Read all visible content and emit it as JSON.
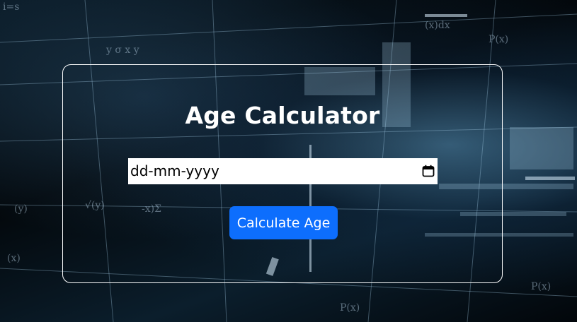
{
  "app": {
    "title": "Age Calculator"
  },
  "date_input": {
    "placeholder": "dd-mm-yyyy",
    "value": ""
  },
  "actions": {
    "calculate_label": "Calculate Age"
  },
  "icons": {
    "date_picker": "calendar-icon"
  },
  "colors": {
    "button": "#0d6efd",
    "text": "#ffffff",
    "card_border": "#ffffff"
  }
}
